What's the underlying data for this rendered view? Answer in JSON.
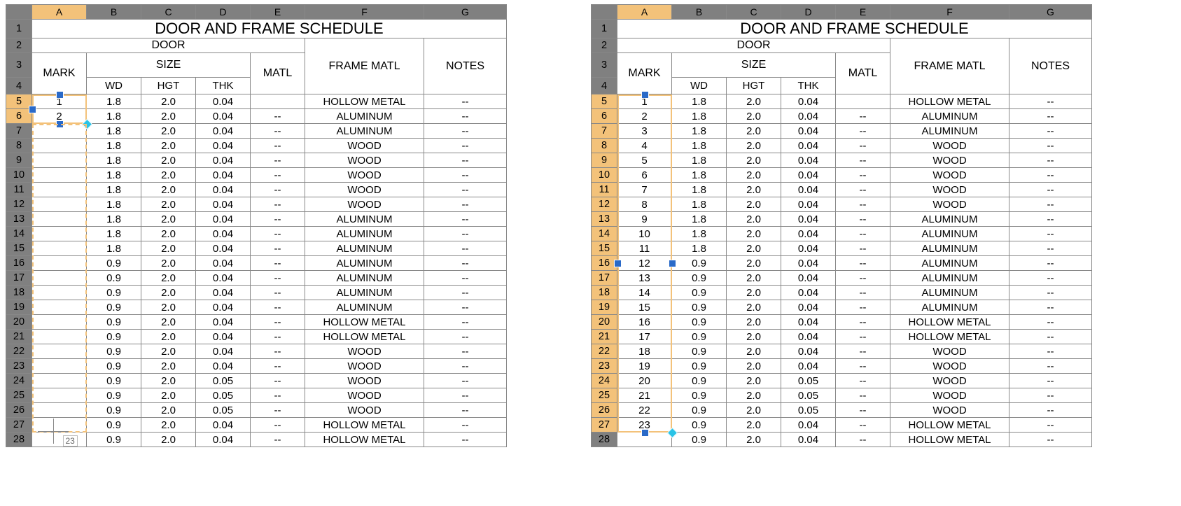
{
  "columns": [
    "A",
    "B",
    "C",
    "D",
    "E",
    "F",
    "G"
  ],
  "title": "DOOR AND FRAME SCHEDULE",
  "headers": {
    "door": "DOOR",
    "size": "SIZE",
    "mark": "MARK",
    "matl": "MATL",
    "framematl": "FRAME MATL",
    "notes": "NOTES",
    "wd": "WD",
    "hgt": "HGT",
    "thk": "THK"
  },
  "left": {
    "active_rows": [
      5,
      6
    ],
    "rows": [
      {
        "r": 5,
        "mark": "1",
        "wd": "1.8",
        "hgt": "2.0",
        "thk": "0.04",
        "matl": "",
        "frame": "HOLLOW METAL",
        "notes": "--"
      },
      {
        "r": 6,
        "mark": "2",
        "wd": "1.8",
        "hgt": "2.0",
        "thk": "0.04",
        "matl": "--",
        "frame": "ALUMINUM",
        "notes": "--"
      },
      {
        "r": 7,
        "mark": "",
        "wd": "1.8",
        "hgt": "2.0",
        "thk": "0.04",
        "matl": "--",
        "frame": "ALUMINUM",
        "notes": "--"
      },
      {
        "r": 8,
        "mark": "",
        "wd": "1.8",
        "hgt": "2.0",
        "thk": "0.04",
        "matl": "--",
        "frame": "WOOD",
        "notes": "--"
      },
      {
        "r": 9,
        "mark": "",
        "wd": "1.8",
        "hgt": "2.0",
        "thk": "0.04",
        "matl": "--",
        "frame": "WOOD",
        "notes": "--"
      },
      {
        "r": 10,
        "mark": "",
        "wd": "1.8",
        "hgt": "2.0",
        "thk": "0.04",
        "matl": "--",
        "frame": "WOOD",
        "notes": "--"
      },
      {
        "r": 11,
        "mark": "",
        "wd": "1.8",
        "hgt": "2.0",
        "thk": "0.04",
        "matl": "--",
        "frame": "WOOD",
        "notes": "--"
      },
      {
        "r": 12,
        "mark": "",
        "wd": "1.8",
        "hgt": "2.0",
        "thk": "0.04",
        "matl": "--",
        "frame": "WOOD",
        "notes": "--"
      },
      {
        "r": 13,
        "mark": "",
        "wd": "1.8",
        "hgt": "2.0",
        "thk": "0.04",
        "matl": "--",
        "frame": "ALUMINUM",
        "notes": "--"
      },
      {
        "r": 14,
        "mark": "",
        "wd": "1.8",
        "hgt": "2.0",
        "thk": "0.04",
        "matl": "--",
        "frame": "ALUMINUM",
        "notes": "--"
      },
      {
        "r": 15,
        "mark": "",
        "wd": "1.8",
        "hgt": "2.0",
        "thk": "0.04",
        "matl": "--",
        "frame": "ALUMINUM",
        "notes": "--"
      },
      {
        "r": 16,
        "mark": "",
        "wd": "0.9",
        "hgt": "2.0",
        "thk": "0.04",
        "matl": "--",
        "frame": "ALUMINUM",
        "notes": "--"
      },
      {
        "r": 17,
        "mark": "",
        "wd": "0.9",
        "hgt": "2.0",
        "thk": "0.04",
        "matl": "--",
        "frame": "ALUMINUM",
        "notes": "--"
      },
      {
        "r": 18,
        "mark": "",
        "wd": "0.9",
        "hgt": "2.0",
        "thk": "0.04",
        "matl": "--",
        "frame": "ALUMINUM",
        "notes": "--"
      },
      {
        "r": 19,
        "mark": "",
        "wd": "0.9",
        "hgt": "2.0",
        "thk": "0.04",
        "matl": "--",
        "frame": "ALUMINUM",
        "notes": "--"
      },
      {
        "r": 20,
        "mark": "",
        "wd": "0.9",
        "hgt": "2.0",
        "thk": "0.04",
        "matl": "--",
        "frame": "HOLLOW METAL",
        "notes": "--"
      },
      {
        "r": 21,
        "mark": "",
        "wd": "0.9",
        "hgt": "2.0",
        "thk": "0.04",
        "matl": "--",
        "frame": "HOLLOW METAL",
        "notes": "--"
      },
      {
        "r": 22,
        "mark": "",
        "wd": "0.9",
        "hgt": "2.0",
        "thk": "0.04",
        "matl": "--",
        "frame": "WOOD",
        "notes": "--"
      },
      {
        "r": 23,
        "mark": "",
        "wd": "0.9",
        "hgt": "2.0",
        "thk": "0.04",
        "matl": "--",
        "frame": "WOOD",
        "notes": "--"
      },
      {
        "r": 24,
        "mark": "",
        "wd": "0.9",
        "hgt": "2.0",
        "thk": "0.05",
        "matl": "--",
        "frame": "WOOD",
        "notes": "--"
      },
      {
        "r": 25,
        "mark": "",
        "wd": "0.9",
        "hgt": "2.0",
        "thk": "0.05",
        "matl": "--",
        "frame": "WOOD",
        "notes": "--"
      },
      {
        "r": 26,
        "mark": "",
        "wd": "0.9",
        "hgt": "2.0",
        "thk": "0.05",
        "matl": "--",
        "frame": "WOOD",
        "notes": "--"
      },
      {
        "r": 27,
        "mark": "",
        "wd": "0.9",
        "hgt": "2.0",
        "thk": "0.04",
        "matl": "--",
        "frame": "HOLLOW METAL",
        "notes": "--"
      },
      {
        "r": 28,
        "mark": "",
        "wd": "0.9",
        "hgt": "2.0",
        "thk": "0.04",
        "matl": "--",
        "frame": "HOLLOW METAL",
        "notes": "--"
      }
    ],
    "ghost_value": "23"
  },
  "right": {
    "active_rows": [
      5,
      6,
      7,
      8,
      9,
      10,
      11,
      12,
      13,
      14,
      15,
      16,
      17,
      18,
      19,
      20,
      21,
      22,
      23,
      24,
      25,
      26,
      27
    ],
    "rows": [
      {
        "r": 5,
        "mark": "1",
        "wd": "1.8",
        "hgt": "2.0",
        "thk": "0.04",
        "matl": "",
        "frame": "HOLLOW METAL",
        "notes": "--"
      },
      {
        "r": 6,
        "mark": "2",
        "wd": "1.8",
        "hgt": "2.0",
        "thk": "0.04",
        "matl": "--",
        "frame": "ALUMINUM",
        "notes": "--"
      },
      {
        "r": 7,
        "mark": "3",
        "wd": "1.8",
        "hgt": "2.0",
        "thk": "0.04",
        "matl": "--",
        "frame": "ALUMINUM",
        "notes": "--"
      },
      {
        "r": 8,
        "mark": "4",
        "wd": "1.8",
        "hgt": "2.0",
        "thk": "0.04",
        "matl": "--",
        "frame": "WOOD",
        "notes": "--"
      },
      {
        "r": 9,
        "mark": "5",
        "wd": "1.8",
        "hgt": "2.0",
        "thk": "0.04",
        "matl": "--",
        "frame": "WOOD",
        "notes": "--"
      },
      {
        "r": 10,
        "mark": "6",
        "wd": "1.8",
        "hgt": "2.0",
        "thk": "0.04",
        "matl": "--",
        "frame": "WOOD",
        "notes": "--"
      },
      {
        "r": 11,
        "mark": "7",
        "wd": "1.8",
        "hgt": "2.0",
        "thk": "0.04",
        "matl": "--",
        "frame": "WOOD",
        "notes": "--"
      },
      {
        "r": 12,
        "mark": "8",
        "wd": "1.8",
        "hgt": "2.0",
        "thk": "0.04",
        "matl": "--",
        "frame": "WOOD",
        "notes": "--"
      },
      {
        "r": 13,
        "mark": "9",
        "wd": "1.8",
        "hgt": "2.0",
        "thk": "0.04",
        "matl": "--",
        "frame": "ALUMINUM",
        "notes": "--"
      },
      {
        "r": 14,
        "mark": "10",
        "wd": "1.8",
        "hgt": "2.0",
        "thk": "0.04",
        "matl": "--",
        "frame": "ALUMINUM",
        "notes": "--"
      },
      {
        "r": 15,
        "mark": "11",
        "wd": "1.8",
        "hgt": "2.0",
        "thk": "0.04",
        "matl": "--",
        "frame": "ALUMINUM",
        "notes": "--"
      },
      {
        "r": 16,
        "mark": "12",
        "wd": "0.9",
        "hgt": "2.0",
        "thk": "0.04",
        "matl": "--",
        "frame": "ALUMINUM",
        "notes": "--"
      },
      {
        "r": 17,
        "mark": "13",
        "wd": "0.9",
        "hgt": "2.0",
        "thk": "0.04",
        "matl": "--",
        "frame": "ALUMINUM",
        "notes": "--"
      },
      {
        "r": 18,
        "mark": "14",
        "wd": "0.9",
        "hgt": "2.0",
        "thk": "0.04",
        "matl": "--",
        "frame": "ALUMINUM",
        "notes": "--"
      },
      {
        "r": 19,
        "mark": "15",
        "wd": "0.9",
        "hgt": "2.0",
        "thk": "0.04",
        "matl": "--",
        "frame": "ALUMINUM",
        "notes": "--"
      },
      {
        "r": 20,
        "mark": "16",
        "wd": "0.9",
        "hgt": "2.0",
        "thk": "0.04",
        "matl": "--",
        "frame": "HOLLOW METAL",
        "notes": "--"
      },
      {
        "r": 21,
        "mark": "17",
        "wd": "0.9",
        "hgt": "2.0",
        "thk": "0.04",
        "matl": "--",
        "frame": "HOLLOW METAL",
        "notes": "--"
      },
      {
        "r": 22,
        "mark": "18",
        "wd": "0.9",
        "hgt": "2.0",
        "thk": "0.04",
        "matl": "--",
        "frame": "WOOD",
        "notes": "--"
      },
      {
        "r": 23,
        "mark": "19",
        "wd": "0.9",
        "hgt": "2.0",
        "thk": "0.04",
        "matl": "--",
        "frame": "WOOD",
        "notes": "--"
      },
      {
        "r": 24,
        "mark": "20",
        "wd": "0.9",
        "hgt": "2.0",
        "thk": "0.05",
        "matl": "--",
        "frame": "WOOD",
        "notes": "--"
      },
      {
        "r": 25,
        "mark": "21",
        "wd": "0.9",
        "hgt": "2.0",
        "thk": "0.05",
        "matl": "--",
        "frame": "WOOD",
        "notes": "--"
      },
      {
        "r": 26,
        "mark": "22",
        "wd": "0.9",
        "hgt": "2.0",
        "thk": "0.05",
        "matl": "--",
        "frame": "WOOD",
        "notes": "--"
      },
      {
        "r": 27,
        "mark": "23",
        "wd": "0.9",
        "hgt": "2.0",
        "thk": "0.04",
        "matl": "--",
        "frame": "HOLLOW METAL",
        "notes": "--"
      },
      {
        "r": 28,
        "mark": "",
        "wd": "0.9",
        "hgt": "2.0",
        "thk": "0.04",
        "matl": "--",
        "frame": "HOLLOW METAL",
        "notes": "--"
      }
    ]
  }
}
